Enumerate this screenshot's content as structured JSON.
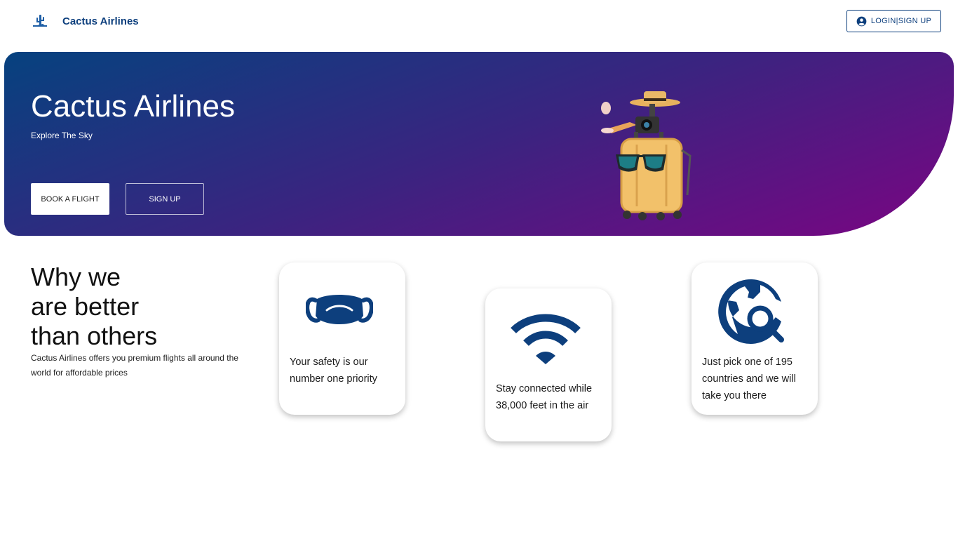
{
  "header": {
    "brand_name": "Cactus Airlines",
    "login_label": "LOGIN|SIGN UP",
    "brand_color": "#0d3f7d"
  },
  "hero": {
    "title": "Cactus Airlines",
    "subtitle": "Explore The Sky",
    "book_label": "BOOK A FLIGHT",
    "signup_label": "SIGN UP",
    "gradient": [
      "#06427f",
      "#3a2480",
      "#7a0583"
    ]
  },
  "why": {
    "title_lines": [
      "Why we",
      "are better",
      "than others"
    ],
    "description": "Cactus Airlines offers you premium flights all around the world for affordable prices"
  },
  "features": [
    {
      "icon": "mask-icon",
      "lines": [
        "Your safety is our",
        "number one priority"
      ]
    },
    {
      "icon": "wifi-icon",
      "lines": [
        "Stay connected while",
        "38,000 feet in the air"
      ]
    },
    {
      "icon": "globe-search-icon",
      "lines": [
        "Just pick one of 195",
        "countries and we will",
        "take you there"
      ]
    }
  ]
}
